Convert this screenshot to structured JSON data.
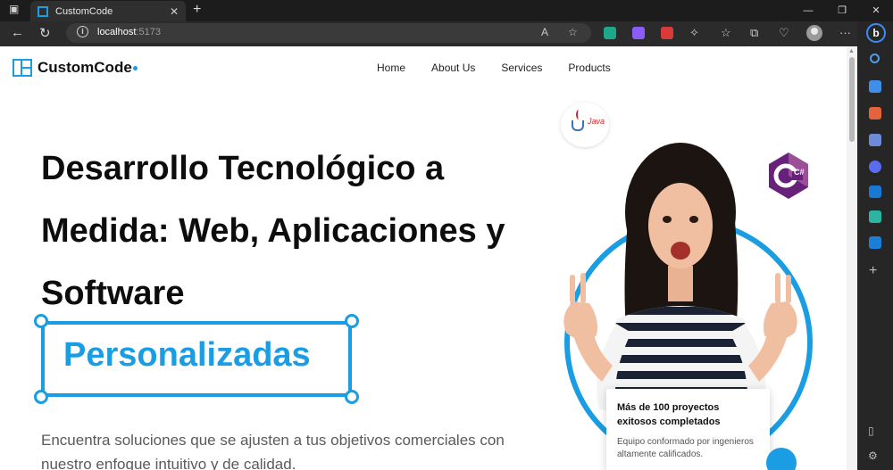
{
  "browser": {
    "tab_title": "CustomCode",
    "url_host": "localhost",
    "url_port": ":5173"
  },
  "site": {
    "brand": "CustomCode",
    "nav": [
      "Home",
      "About Us",
      "Services",
      "Products"
    ],
    "hero": {
      "title": "Desarrollo Tecnológico a Medida: Web, Aplicaciones y Software",
      "highlight": "Personalizadas",
      "subtitle": "Encuentra soluciones que se ajusten a tus objetivos comerciales con nuestro enfoque intuitivo y de calidad."
    },
    "badges": {
      "java": "Java",
      "csharp": "C#"
    },
    "stat_card": {
      "title": "Más de 100 proyectos exitosos completados",
      "text": "Equipo conformado por ingenieros altamente calificados."
    }
  },
  "colors": {
    "accent": "#1a9de2"
  }
}
